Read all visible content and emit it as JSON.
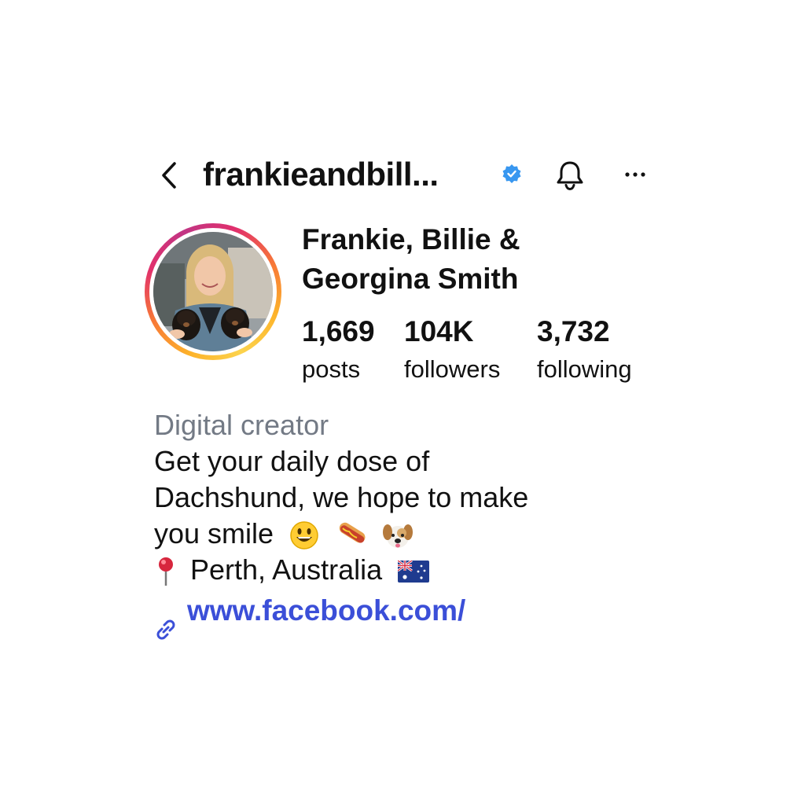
{
  "header": {
    "username": "frankieandbill...",
    "verified_color": "#3897f0"
  },
  "profile": {
    "full_name_line1": "Frankie, Billie &",
    "full_name_line2": "Georgina Smith"
  },
  "stats": {
    "posts": {
      "value": "1,669",
      "label": "posts"
    },
    "followers": {
      "value": "104K",
      "label": "followers"
    },
    "following": {
      "value": "3,732",
      "label": "following"
    }
  },
  "bio": {
    "category": "Digital creator",
    "line1": "Get your daily dose of",
    "line2": "Dachshund, we hope to make",
    "line3": "you smile",
    "location": "Perth, Australia",
    "link": "www.facebook.com/"
  },
  "colors": {
    "link": "#3b4fd8",
    "category": "#737a85"
  },
  "icons": [
    "back-chevron-icon",
    "verified-badge-icon",
    "bell-icon",
    "more-dots-icon",
    "link-icon",
    "pin-icon",
    "smiley-emoji",
    "hotdog-emoji",
    "dog-emoji",
    "australia-flag-emoji"
  ]
}
